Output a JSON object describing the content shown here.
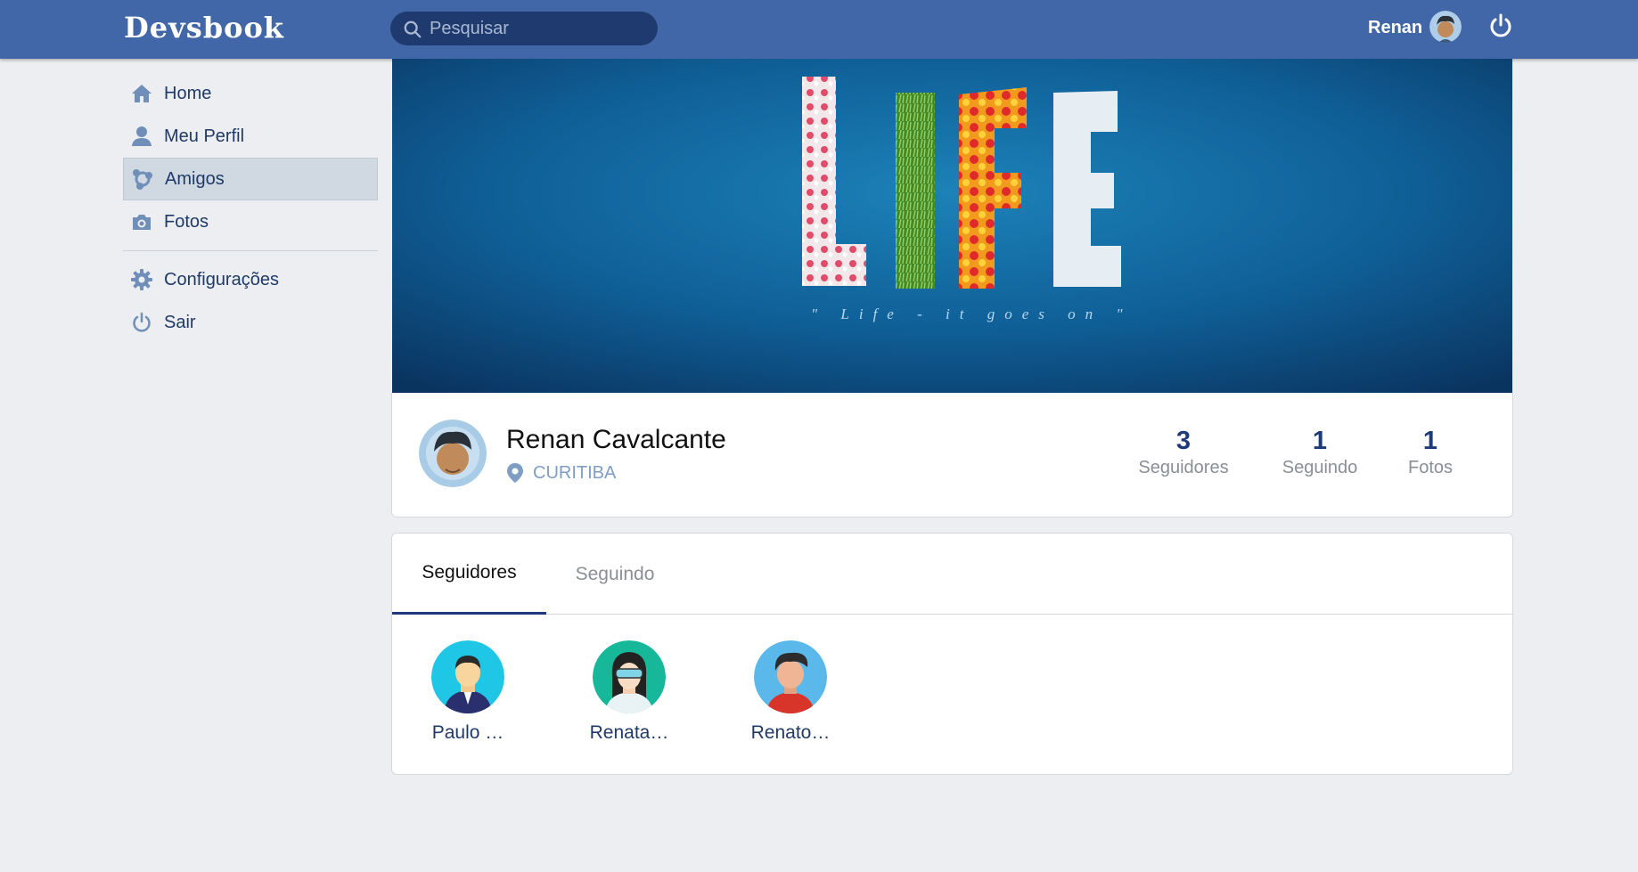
{
  "header": {
    "logo": "Devsbook",
    "search_placeholder": "Pesquisar",
    "user_name": "Renan"
  },
  "sidebar": {
    "items": [
      {
        "label": "Home",
        "icon": "home-icon"
      },
      {
        "label": "Meu Perfil",
        "icon": "user-icon"
      },
      {
        "label": "Amigos",
        "icon": "friends-icon",
        "active": true
      },
      {
        "label": "Fotos",
        "icon": "camera-icon"
      },
      {
        "label": "Configurações",
        "icon": "gear-icon"
      },
      {
        "label": "Sair",
        "icon": "power-icon"
      }
    ]
  },
  "cover": {
    "word": "LIFE",
    "tagline": "\" Life - it goes on \""
  },
  "profile": {
    "name": "Renan Cavalcante",
    "location": "CURITIBA",
    "stats": [
      {
        "value": "3",
        "label": "Seguidores"
      },
      {
        "value": "1",
        "label": "Seguindo"
      },
      {
        "value": "1",
        "label": "Fotos"
      }
    ]
  },
  "tabs": [
    {
      "label": "Seguidores",
      "active": true
    },
    {
      "label": "Seguindo",
      "active": false
    }
  ],
  "followers": [
    {
      "name": "Paulo …"
    },
    {
      "name": "Renata…"
    },
    {
      "name": "Renato…"
    }
  ],
  "colors": {
    "topbar": "#4267a8",
    "search_bg": "#1f3a6e",
    "accent": "#1f3a7a",
    "sidebar_active": "#d0d8e1",
    "page_bg": "#eceef1"
  }
}
